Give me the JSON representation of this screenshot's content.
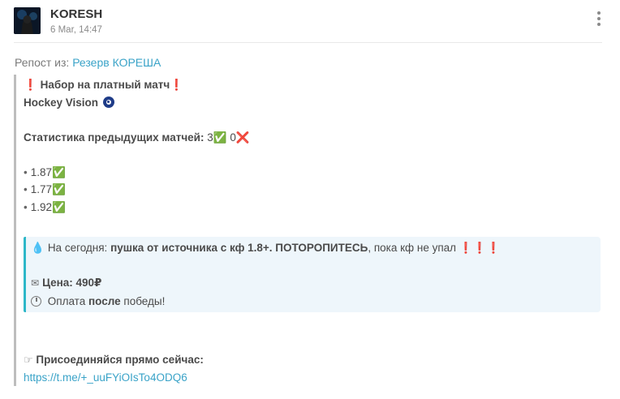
{
  "post": {
    "author": "KORESH",
    "date": "6 Mar, 14:47",
    "repost_prefix": "Репост из:",
    "repost_source": "Резерв КОРЕША"
  },
  "message": {
    "line1_excl_left": "❗",
    "line1_text": "Набор на платный матч",
    "line1_excl_right": "❗",
    "line2_text": "Hockey Vision",
    "stats_label": "Статистика предыдущих матчей:",
    "stats_wins": "3",
    "stats_check": "✅",
    "stats_losses": "0",
    "stats_cross": "❌",
    "odds": [
      {
        "bullet": "•",
        "value": "1.87",
        "mark": "✅"
      },
      {
        "bullet": "•",
        "value": "1.77",
        "mark": "✅"
      },
      {
        "bullet": "•",
        "value": "1.92",
        "mark": "✅"
      }
    ]
  },
  "highlight": {
    "icon_drop": "💧",
    "today_prefix": "На сегодня:",
    "today_bold": "пушка от источника с кф 1.8+. ПОТОРОПИТЕСЬ",
    "today_suffix": ", пока кф не упал",
    "today_excl": "❗❗❗",
    "icon_envelope": "✉",
    "price": "Цена: 490₽",
    "pay_prefix": "Оплата",
    "pay_bold": "после",
    "pay_suffix": "победы!"
  },
  "footer": {
    "icon_hand": "☞",
    "join_text": "Присоединяйся прямо сейчас:",
    "link": "https://t.me/+_uuFYiOIsTo4ODQ6"
  },
  "colors": {
    "accent": "#2db7c8",
    "link": "#3aa3c8",
    "red": "#d32f2f"
  }
}
